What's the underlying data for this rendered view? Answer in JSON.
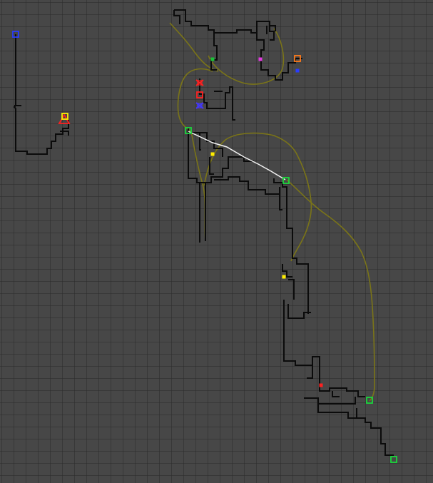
{
  "map": {
    "view": "automap",
    "background_color": "#474747",
    "grid_color": "#2a2a2a",
    "wall_color": "#0b0b0b",
    "trail_color": "#7a7418",
    "route_color": "#f2f2f2",
    "markers": [
      {
        "name": "start-marker",
        "icon": "blue-square-icon",
        "color": "#2a3cff"
      },
      {
        "name": "warning-marker",
        "icon": "red-triangle-icon",
        "color": "#ff2020"
      },
      {
        "name": "key-marker",
        "icon": "yellow-square-icon",
        "color": "#ffee00"
      },
      {
        "name": "item-marker-green-1",
        "icon": "green-dot-icon",
        "color": "#19c23a"
      },
      {
        "name": "item-marker-magenta",
        "icon": "magenta-dot-icon",
        "color": "#e23be0"
      },
      {
        "name": "objective-marker",
        "icon": "orange-square-icon",
        "color": "#ff7a1a"
      },
      {
        "name": "blue-dot-marker",
        "icon": "blue-dot-icon",
        "color": "#2a3cff"
      },
      {
        "name": "enemy-marker-1",
        "icon": "red-x-icon",
        "color": "#ff2020"
      },
      {
        "name": "enemy-marker-2",
        "icon": "red-square-icon",
        "color": "#ff2020"
      },
      {
        "name": "enemy-marker-3",
        "icon": "red-x-icon",
        "color": "#ff2020"
      },
      {
        "name": "enemy-marker-4",
        "icon": "blue-x-icon",
        "color": "#3a3aff"
      },
      {
        "name": "waypoint-green-1",
        "icon": "green-square-icon",
        "color": "#1bd63c"
      },
      {
        "name": "key-yellow-1",
        "icon": "yellow-dot-icon",
        "color": "#ffee00"
      },
      {
        "name": "waypoint-green-2",
        "icon": "green-square-icon",
        "color": "#1bd63c"
      },
      {
        "name": "key-yellow-2",
        "icon": "yellow-dot-icon",
        "color": "#ffee00"
      },
      {
        "name": "red-dot-marker",
        "icon": "red-dot-icon",
        "color": "#ff2020"
      },
      {
        "name": "waypoint-green-3",
        "icon": "green-square-icon",
        "color": "#1bd63c"
      },
      {
        "name": "exit-marker",
        "icon": "green-square-icon",
        "color": "#1bd63c"
      }
    ]
  }
}
